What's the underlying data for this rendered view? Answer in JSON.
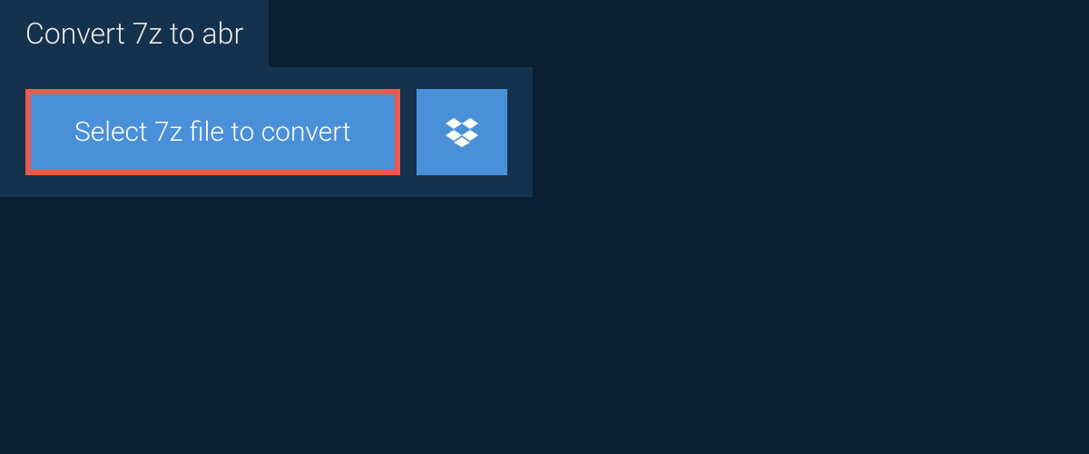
{
  "tab": {
    "title": "Convert 7z to abr"
  },
  "upload": {
    "select_label": "Select 7z file to convert",
    "dropbox_icon": "dropbox-icon"
  },
  "colors": {
    "accent": "#4a90d9",
    "highlight": "#e85a4f",
    "panel": "#14324d",
    "background": "#0a1f33"
  }
}
